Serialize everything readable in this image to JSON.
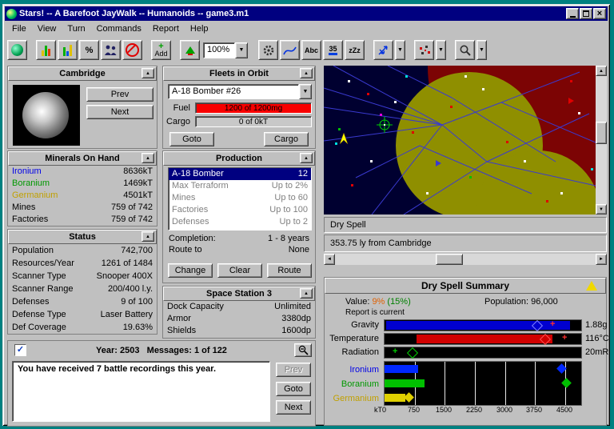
{
  "window": {
    "title": "Stars! -- A Barefoot JayWalk -- Humanoids -- game3.m1"
  },
  "icons": {
    "close": "×",
    "collapse": "▲",
    "dropdown": "▼",
    "scroll_left": "◄",
    "scroll_right": "►",
    "scroll_up": "▲",
    "scroll_down": "▼",
    "check": "✓"
  },
  "menu": {
    "items": [
      "File",
      "View",
      "Turn",
      "Commands",
      "Report",
      "Help"
    ]
  },
  "toolbar": {
    "percent": "%",
    "add": "Add",
    "zoom": "100%",
    "abc": "Abc",
    "count": "35",
    "zzz": "zZz"
  },
  "planet_panel": {
    "title": "Cambridge",
    "prev": "Prev",
    "next": "Next"
  },
  "minerals_panel": {
    "title": "Minerals On Hand",
    "rows": [
      {
        "label": "Ironium",
        "value": "8636kT"
      },
      {
        "label": "Boranium",
        "value": "1469kT"
      },
      {
        "label": "Germanium",
        "value": "4501kT"
      },
      {
        "label": "Mines",
        "value": "759 of 742"
      },
      {
        "label": "Factories",
        "value": "759 of 742"
      }
    ]
  },
  "status_panel": {
    "title": "Status",
    "rows": [
      {
        "label": "Population",
        "value": "742,700"
      },
      {
        "label": "Resources/Year",
        "value": "1261 of 1484"
      },
      {
        "label": "Scanner Type",
        "value": "Snooper 400X"
      },
      {
        "label": "Scanner Range",
        "value": "200/400 l.y."
      },
      {
        "label": "Defenses",
        "value": "9 of 100"
      },
      {
        "label": "Defense Type",
        "value": "Laser Battery"
      },
      {
        "label": "Def Coverage",
        "value": "19.63%"
      }
    ]
  },
  "fleet_panel": {
    "title": "Fleets in Orbit",
    "fleet": "A-18 Bomber #26",
    "fuel_label": "Fuel",
    "fuel_value": "1200 of 1200mg",
    "cargo_label": "Cargo",
    "cargo_value": "0 of 0kT",
    "goto": "Goto",
    "cargo_btn": "Cargo"
  },
  "production_panel": {
    "title": "Production",
    "items": [
      {
        "name": "A-18 Bomber",
        "qty": "12"
      },
      {
        "name": "Max Terraform",
        "qty": "Up to 2%"
      },
      {
        "name": "Mines",
        "qty": "Up to 60"
      },
      {
        "name": "Factories",
        "qty": "Up to 100"
      },
      {
        "name": "Defenses",
        "qty": "Up to 2"
      }
    ],
    "completion_label": "Completion:",
    "completion": "1 - 8 years",
    "route_label": "Route to",
    "route": "None",
    "change": "Change",
    "clear": "Clear",
    "route_btn": "Route"
  },
  "station_panel": {
    "title": "Space Station 3",
    "rows": [
      {
        "label": "Dock Capacity",
        "value": "Unlimited"
      },
      {
        "label": "Armor",
        "value": "3380dp"
      },
      {
        "label": "Shields",
        "value": "1600dp"
      }
    ]
  },
  "map": {
    "name": "Dry Spell",
    "distance": "353.75 ly from Cambridge"
  },
  "summary": {
    "title": "Dry Spell Summary",
    "value_label": "Value:",
    "value": "9%",
    "value_max": "(15%)",
    "pop_label": "Population:",
    "pop": "96,000",
    "report": "Report is current",
    "grav_label": "Gravity",
    "grav": "1.88g",
    "temp_label": "Temperature",
    "temp": "116°C",
    "rad_label": "Radiation",
    "rad": "20mR",
    "iron_label": "Ironium",
    "bor_label": "Boranium",
    "germ_label": "Germanium",
    "axis": [
      "kT0",
      "750",
      "1500",
      "2250",
      "3000",
      "3750",
      "4500"
    ]
  },
  "messages": {
    "year": "Year: 2503",
    "count": "Messages: 1 of 122",
    "body": "You have received 7 battle recordings this year.",
    "prev": "Prev",
    "goto": "Goto",
    "next": "Next"
  },
  "colors": {
    "titlebar": "#000080",
    "desktop": "#008080",
    "ironium": "#0000e8",
    "boranium": "#009800",
    "germanium": "#c0a000",
    "fuel_bar": "#f80000",
    "selection": "#000080",
    "value_current": "#e06000",
    "value_max": "#008000"
  }
}
